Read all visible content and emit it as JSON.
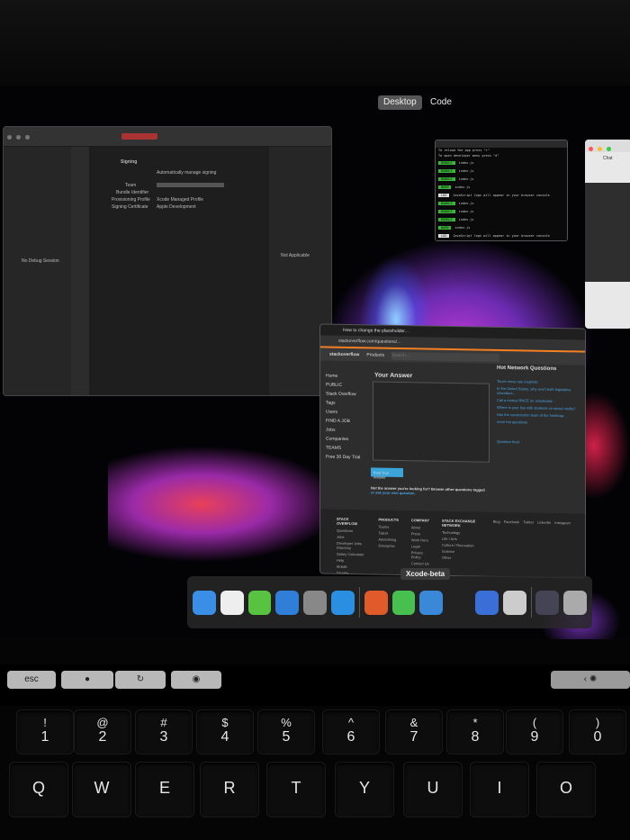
{
  "spaces": {
    "desktop": "Desktop",
    "code": "Code"
  },
  "xcode": {
    "left_label": "No Debug Session",
    "right_label": "Not Applicable",
    "section": "Signing",
    "auto_manage": "Automatically manage signing",
    "team_label": "Team",
    "bundle_label": "Bundle Identifier",
    "profile_label": "Provisioning Profile",
    "profile_value": "Xcode Managed Profile",
    "cert_label": "Signing Certificate",
    "cert_value": "Apple Development"
  },
  "terminal": {
    "lines": [
      "To reload the app press \"r\"",
      "To open developer menu press \"d\""
    ],
    "rows": [
      {
        "tag": "BUNDLE",
        "text": "index.js"
      },
      {
        "tag": "BUNDLE",
        "text": "index.js"
      },
      {
        "tag": "BUNDLE",
        "text": "index.js"
      },
      {
        "tag": "WARN",
        "text": "index.js"
      },
      {
        "tag": "LOG",
        "text": "JavaScript logs will appear in your browser console"
      },
      {
        "tag": "BUNDLE",
        "text": "index.js"
      },
      {
        "tag": "BUNDLE",
        "text": "index.js"
      },
      {
        "tag": "BUNDLE",
        "text": "index.js"
      },
      {
        "tag": "WARN",
        "text": "index.js"
      },
      {
        "tag": "LOG",
        "text": "JavaScript logs will appear in your browser console"
      }
    ]
  },
  "chat": {
    "title": "Chat"
  },
  "stackoverflow": {
    "tab": "How to change the placeholder...",
    "url": "stackoverflow.com/questions/...",
    "logo": "stackoverflow",
    "products": "Products",
    "search_placeholder": "Search...",
    "nav": [
      "Home",
      "PUBLIC",
      "Stack Overflow",
      "Tags",
      "Users",
      "FIND A JOB",
      "Jobs",
      "Companies",
      "TEAMS",
      "Free 30 Day Trial"
    ],
    "answer_heading": "Your Answer",
    "post_button": "Post Your Answer",
    "not_answer": "Not the answer you're looking for? Browse other questions tagged",
    "ask": "or ask your own question.",
    "hot_heading": "Hot Network Questions",
    "hot": [
      "Touch move rule loophole",
      "In the United States, why won't both legislative chambers...",
      "Call a mutual RNCE on unsolicited...",
      "Where is your line with students on social media?",
      "Has the construction team of the Northrop...",
      "more hot questions"
    ],
    "feed": "Question feed",
    "footer": {
      "cols": [
        {
          "title": "STACK OVERFLOW",
          "items": [
            "Questions",
            "Jobs",
            "Developer Jobs Directory",
            "Salary Calculator",
            "Help",
            "Mobile",
            "Disable Responsiveness"
          ]
        },
        {
          "title": "PRODUCTS",
          "items": [
            "Teams",
            "Talent",
            "Advertising",
            "Enterprise"
          ]
        },
        {
          "title": "COMPANY",
          "items": [
            "About",
            "Press",
            "Work Here",
            "Legal",
            "Privacy Policy",
            "Contact Us"
          ]
        },
        {
          "title": "STACK EXCHANGE NETWORK",
          "items": [
            "Technology",
            "Life / Arts",
            "Culture / Recreation",
            "Science",
            "Other"
          ]
        }
      ],
      "social": [
        "Blog",
        "Facebook",
        "Twitter",
        "LinkedIn",
        "Instagram"
      ]
    }
  },
  "dock": {
    "tooltip": "Xcode-beta",
    "apps": [
      {
        "name": "finder",
        "color": "#3a8ee6"
      },
      {
        "name": "calendar",
        "color": "#eee"
      },
      {
        "name": "messages",
        "color": "#58c340"
      },
      {
        "name": "safari",
        "color": "#2f7fd8"
      },
      {
        "name": "system-preferences",
        "color": "#888"
      },
      {
        "name": "vscode",
        "color": "#2a8fe0"
      },
      {
        "name": "sep"
      },
      {
        "name": "brave",
        "color": "#e05a2a"
      },
      {
        "name": "whatsapp",
        "color": "#48c050"
      },
      {
        "name": "xcode",
        "color": "#3a88d8"
      },
      {
        "name": "terminal",
        "color": "#222"
      },
      {
        "name": "simulator",
        "color": "#3a6fd8"
      },
      {
        "name": "react-devtools",
        "color": "#ccc"
      },
      {
        "name": "sep"
      },
      {
        "name": "downloads",
        "color": "#445"
      },
      {
        "name": "trash",
        "color": "#aaa"
      }
    ]
  },
  "touchbar": {
    "esc": "esc"
  },
  "keyboard": {
    "row1": [
      [
        "!",
        "1"
      ],
      [
        "@",
        "2"
      ],
      [
        "#",
        "3"
      ],
      [
        "$",
        "4"
      ],
      [
        "%",
        "5"
      ],
      [
        "^",
        "6"
      ],
      [
        "&",
        "7"
      ],
      [
        "*",
        "8"
      ],
      [
        "(",
        "9"
      ],
      [
        ")",
        "0"
      ]
    ],
    "row2": [
      "Q",
      "W",
      "E",
      "R",
      "T",
      "Y",
      "U",
      "I",
      "O"
    ]
  }
}
